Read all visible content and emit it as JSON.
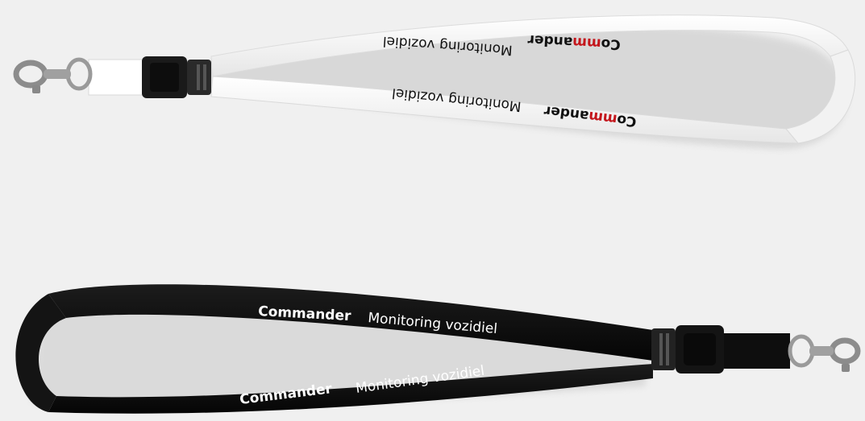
{
  "lanyards": {
    "white": {
      "brand_prefix": "Co",
      "brand_accent": "mm",
      "brand_suffix": "ander",
      "tagline": "Monitoring vozidiel",
      "strap_color": "#ffffff",
      "accent_color": "#c4161c"
    },
    "black": {
      "brand": "Commander",
      "tagline": "Monitoring vozidiel",
      "strap_color": "#0d0d0d",
      "text_color": "#ffffff"
    }
  },
  "icons": {
    "buckle": "buckle-icon",
    "clasp": "lobster-clasp-icon"
  }
}
